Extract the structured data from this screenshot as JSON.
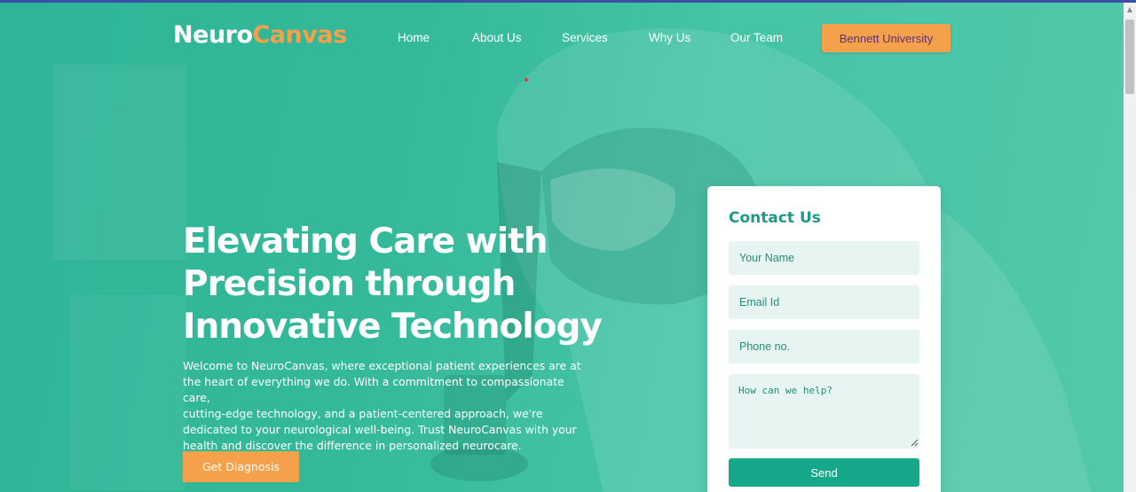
{
  "brand": {
    "name_part1": "Neuro",
    "name_part2": "Canvas",
    "accent": "#f5a04a",
    "primary": "#16a88a"
  },
  "nav": {
    "items": [
      "Home",
      "About Us",
      "Services",
      "Why Us",
      "Our Team"
    ],
    "cta_label": "Bennett University"
  },
  "hero": {
    "headline_lines": [
      "Elevating Care with",
      "Precision through",
      "Innovative Technology"
    ],
    "intro_lines": [
      "Welcome to NeuroCanvas, where exceptional patient experiences are at",
      "the heart of everything we do. With a commitment to compassionate care,",
      "cutting-edge technology, and a patient-centered approach, we're",
      "dedicated to your neurological well-being. Trust NeuroCanvas with your",
      "health and discover the difference in personalized neurocare."
    ],
    "cta_label": "Get Diagnosis",
    "background_icon": "lab-scientist-microscope-photo"
  },
  "contact": {
    "title": "Contact Us",
    "name_placeholder": "Your Name",
    "email_placeholder": "Email Id",
    "phone_placeholder": "Phone no.",
    "message_placeholder": "How can we help?",
    "send_label": "Send"
  }
}
